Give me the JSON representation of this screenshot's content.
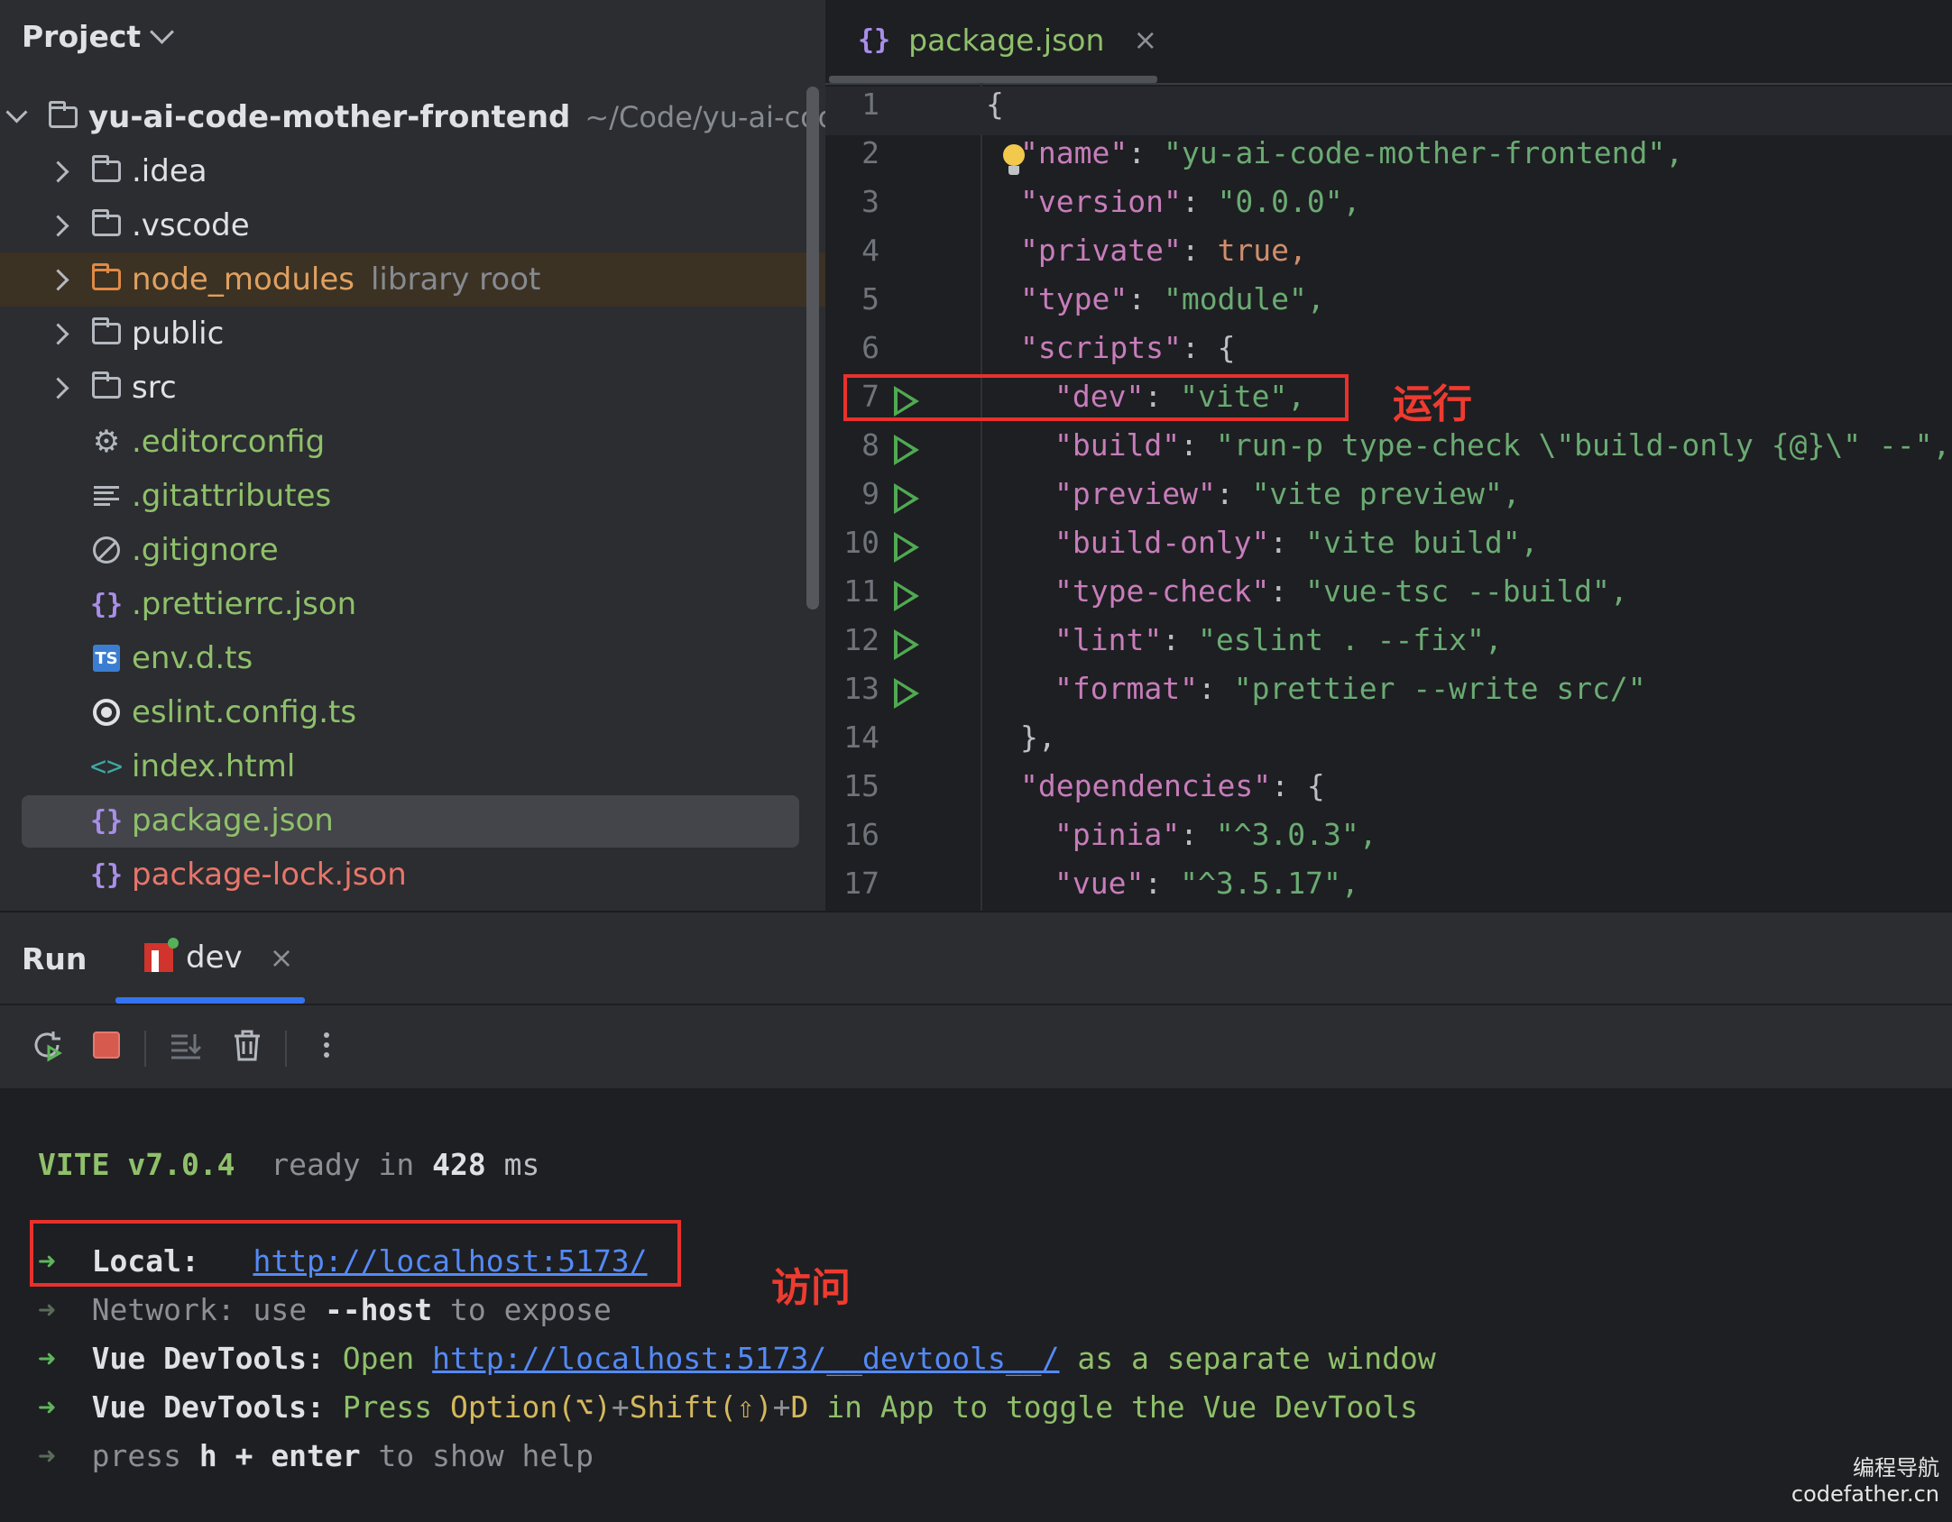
{
  "project": {
    "title": "Project",
    "root": {
      "name": "yu-ai-code-mother-frontend",
      "path": "~/Code/yu-ai-code-"
    },
    "items": [
      {
        "name": ".idea",
        "type": "folder"
      },
      {
        "name": ".vscode",
        "type": "folder"
      },
      {
        "name": "node_modules",
        "type": "folder",
        "hint": "library root"
      },
      {
        "name": "public",
        "type": "folder"
      },
      {
        "name": "src",
        "type": "folder"
      },
      {
        "name": ".editorconfig",
        "type": "file"
      },
      {
        "name": ".gitattributes",
        "type": "file"
      },
      {
        "name": ".gitignore",
        "type": "file"
      },
      {
        "name": ".prettierrc.json",
        "type": "file"
      },
      {
        "name": "env.d.ts",
        "type": "file",
        "badge": "TS"
      },
      {
        "name": "eslint.config.ts",
        "type": "file"
      },
      {
        "name": "index.html",
        "type": "file"
      },
      {
        "name": "package.json",
        "type": "file"
      },
      {
        "name": "package-lock.json",
        "type": "file"
      }
    ]
  },
  "editor": {
    "tab": {
      "label": "package.json",
      "close": "×"
    },
    "lines": [
      {
        "n": "1",
        "text": "{"
      },
      {
        "n": "2",
        "key": "\"name\"",
        "val": "\"yu-ai-code-mother-frontend\","
      },
      {
        "n": "3",
        "key": "\"version\"",
        "val": "\"0.0.0\","
      },
      {
        "n": "4",
        "key": "\"private\"",
        "val": "true,"
      },
      {
        "n": "5",
        "key": "\"type\"",
        "val": "\"module\","
      },
      {
        "n": "6",
        "key": "\"scripts\"",
        "val": "{"
      },
      {
        "n": "7",
        "key": "\"dev\"",
        "val": "\"vite\","
      },
      {
        "n": "8",
        "key": "\"build\"",
        "val": "\"run-p type-check \\\"build-only {@}\\\" --\","
      },
      {
        "n": "9",
        "key": "\"preview\"",
        "val": "\"vite preview\","
      },
      {
        "n": "10",
        "key": "\"build-only\"",
        "val": "\"vite build\","
      },
      {
        "n": "11",
        "key": "\"type-check\"",
        "val": "\"vue-tsc --build\","
      },
      {
        "n": "12",
        "key": "\"lint\"",
        "val": "\"eslint . --fix\","
      },
      {
        "n": "13",
        "key": "\"format\"",
        "val": "\"prettier --write src/\""
      },
      {
        "n": "14",
        "text": "},"
      },
      {
        "n": "15",
        "key": "\"dependencies\"",
        "val": "{"
      },
      {
        "n": "16",
        "key": "\"pinia\"",
        "val": "\"^3.0.3\","
      },
      {
        "n": "17",
        "key": "\"vue\"",
        "val": "\"^3.5.17\","
      }
    ]
  },
  "annotations": {
    "run": "运行",
    "visit": "访问"
  },
  "run_panel": {
    "title": "Run",
    "tab": {
      "label": "dev",
      "close": "×"
    },
    "console": {
      "vite": "VITE v7.0.4",
      "ready": "ready in",
      "ms_value": "428",
      "ms_unit": "ms",
      "arrow": "➜",
      "local_label": "Local:",
      "local_url": "http://localhost:5173/",
      "network_label": "Network:",
      "network_use": "use",
      "network_host": "--host",
      "network_expose": "to expose",
      "devtools_label": "Vue DevTools:",
      "devtools_open": "Open",
      "devtools_url": "http://localhost:5173/__devtools__/",
      "devtools_sep": "as a separate window",
      "devtools2_press": "Press",
      "devtools2_keys": "Option(⌥)",
      "devtools2_plus": "+",
      "devtools2_shift": "Shift(⇧)",
      "devtools2_plus2": "+",
      "devtools2_d": "D",
      "devtools2_rest": "in App to toggle the Vue DevTools",
      "help_press": "press",
      "help_keys": "h + enter",
      "help_rest": "to show help"
    }
  },
  "watermark": {
    "cn": "编程导航",
    "site": "codefather.cn"
  },
  "colors": {
    "accent": "#3574f0",
    "annotation": "#e8312c",
    "run_icon": "#4faa52"
  }
}
